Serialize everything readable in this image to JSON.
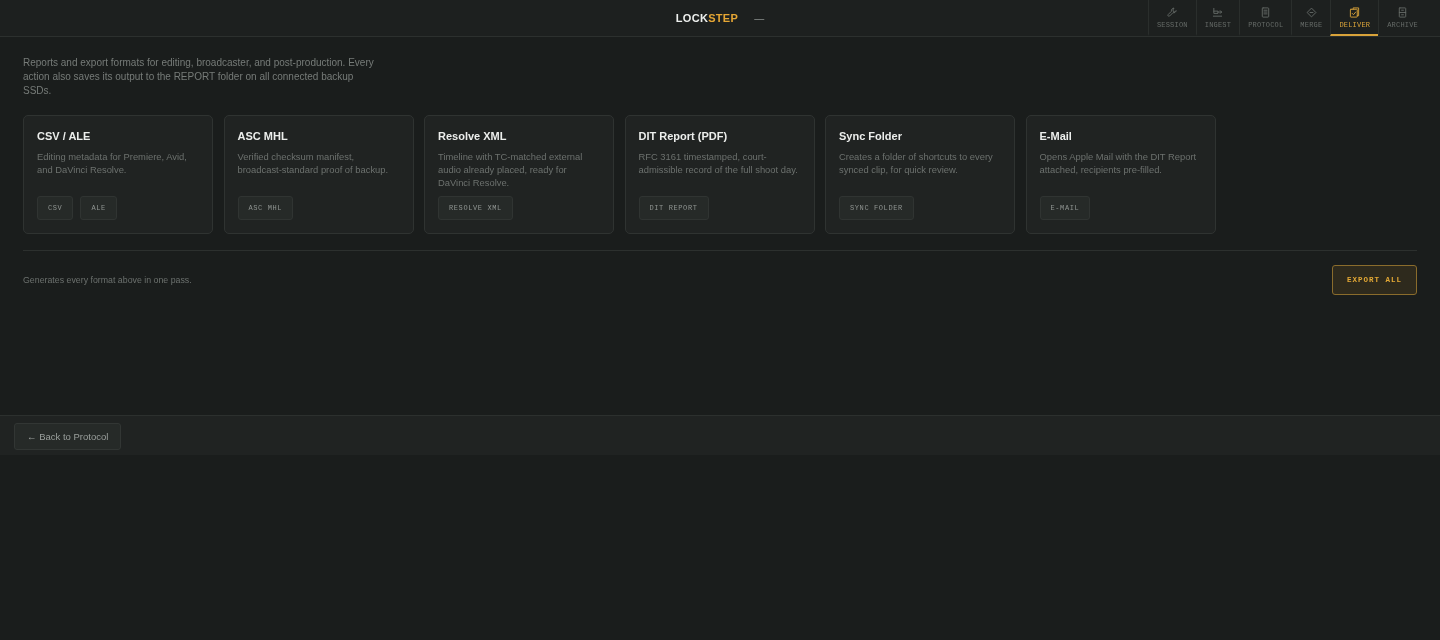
{
  "header": {
    "logo": {
      "prefix": "LOCK",
      "accent": "STEP"
    },
    "session_status": "—",
    "tabs": [
      {
        "label": "SESSION",
        "selected": false
      },
      {
        "label": "INGEST",
        "selected": false
      },
      {
        "label": "PROTOCOL",
        "selected": false
      },
      {
        "label": "MERGE",
        "selected": false
      },
      {
        "label": "DELIVER",
        "selected": true
      },
      {
        "label": "ARCHIVE",
        "selected": false
      }
    ]
  },
  "intro": "Reports and export formats for editing, broadcaster, and post-production. Every action also saves its output to the REPORT folder on all connected backup SSDs.",
  "cards": [
    {
      "title": "CSV / ALE",
      "description": "Editing metadata for Premiere, Avid, and DaVinci Resolve.",
      "buttons": [
        "CSV",
        "ALE"
      ]
    },
    {
      "title": "ASC MHL",
      "description": "Verified checksum manifest, broadcast-standard proof of backup.",
      "buttons": [
        "ASC MHL"
      ]
    },
    {
      "title": "Resolve XML",
      "description": "Timeline with TC-matched external audio already placed, ready for DaVinci Resolve.",
      "buttons": [
        "RESOLVE XML"
      ]
    },
    {
      "title": "DIT Report (PDF)",
      "description": "RFC 3161 timestamped, court-admissible record of the full shoot day.",
      "buttons": [
        "DIT REPORT"
      ]
    },
    {
      "title": "Sync Folder",
      "description": "Creates a folder of shortcuts to every synced clip, for quick review.",
      "buttons": [
        "SYNC FOLDER"
      ]
    },
    {
      "title": "E-Mail",
      "description": "Opens Apple Mail with the DIT Report attached, recipients pre-filled.",
      "buttons": [
        "E-MAIL"
      ]
    }
  ],
  "bulk": {
    "note": "Generates every format above in one pass.",
    "button": "EXPORT ALL"
  },
  "footer": {
    "back_button": "← Back to Protocol"
  }
}
